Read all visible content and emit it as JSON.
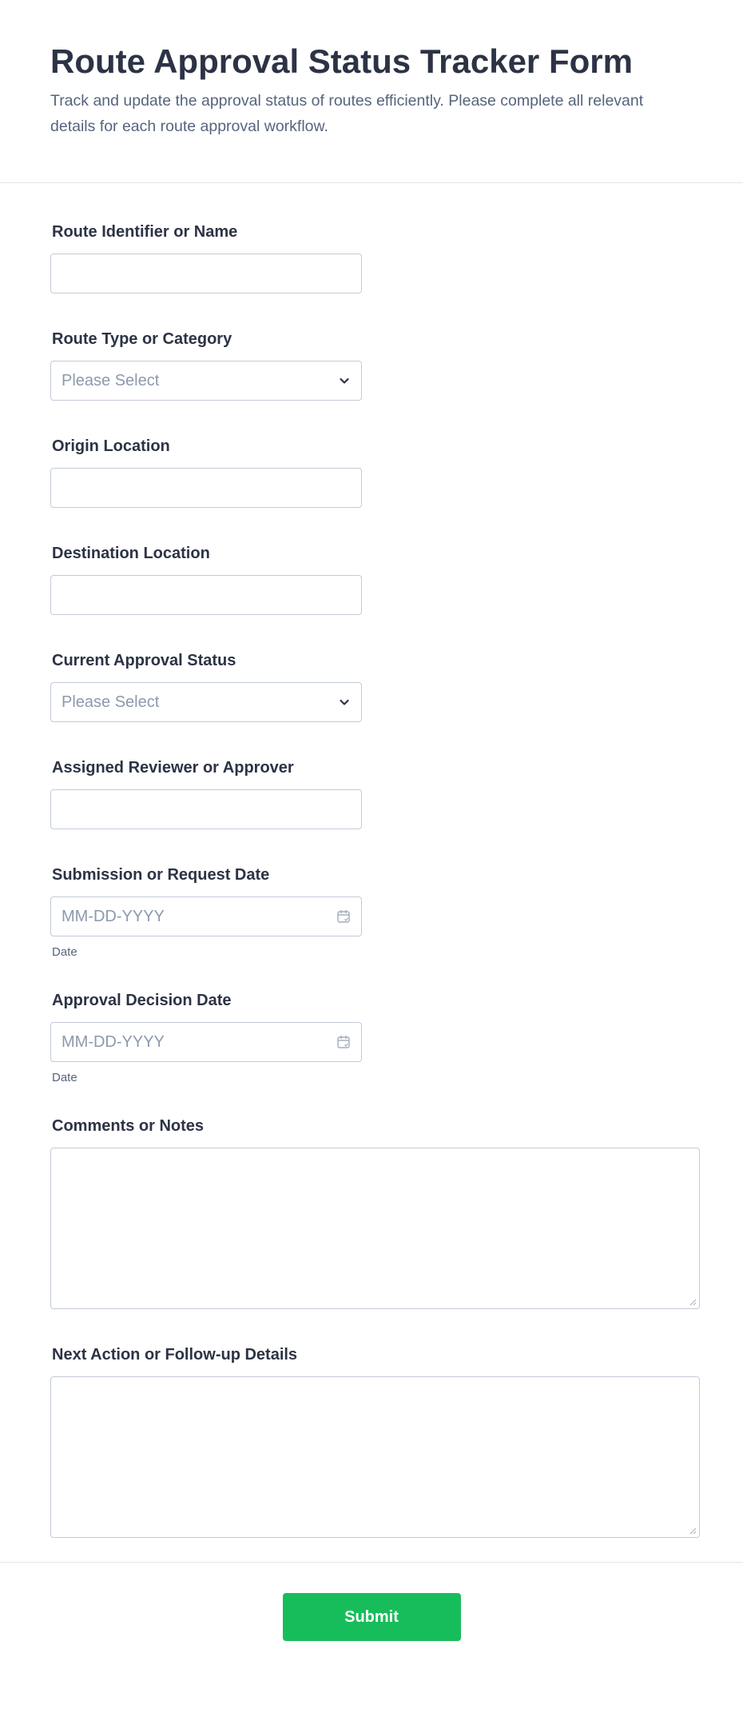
{
  "header": {
    "title": "Route Approval Status Tracker Form",
    "subtitle": "Track and update the approval status of routes efficiently. Please complete all relevant details for each route approval workflow."
  },
  "fields": {
    "route_identifier": {
      "label": "Route Identifier or Name",
      "value": ""
    },
    "route_type": {
      "label": "Route Type or Category",
      "placeholder": "Please Select",
      "icon": "chevron-down-icon"
    },
    "origin": {
      "label": "Origin Location",
      "value": ""
    },
    "destination": {
      "label": "Destination Location",
      "value": ""
    },
    "approval_status": {
      "label": "Current Approval Status",
      "placeholder": "Please Select",
      "icon": "chevron-down-icon"
    },
    "reviewer": {
      "label": "Assigned Reviewer or Approver",
      "value": ""
    },
    "submission_date": {
      "label": "Submission or Request Date",
      "placeholder": "MM-DD-YYYY",
      "sublabel": "Date",
      "icon": "calendar-icon"
    },
    "decision_date": {
      "label": "Approval Decision Date",
      "placeholder": "MM-DD-YYYY",
      "sublabel": "Date",
      "icon": "calendar-icon"
    },
    "comments": {
      "label": "Comments or Notes",
      "value": ""
    },
    "next_action": {
      "label": "Next Action or Follow-up Details",
      "value": ""
    }
  },
  "footer": {
    "submit_label": "Submit"
  },
  "colors": {
    "accent": "#18bd5b",
    "title_text": "#2c3345",
    "subtitle_text": "#57647e",
    "border": "#c3cad8",
    "placeholder": "#8d99ad"
  }
}
